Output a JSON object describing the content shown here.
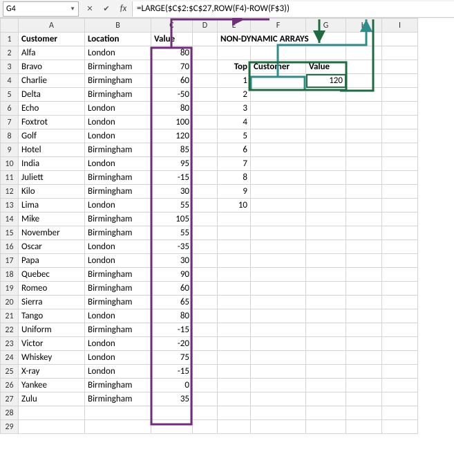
{
  "name_box": "G4",
  "formula": "=LARGE($C$2:$C$27,ROW(F4)-ROW(F$3))",
  "col_headers": [
    "A",
    "B",
    "C",
    "D",
    "E",
    "F",
    "G",
    "H",
    "I"
  ],
  "headers_row1": {
    "customer": "Customer",
    "location": "Location",
    "value": "Value",
    "nonDyn": "NON-DYNAMIC ARRAYS"
  },
  "sub_headers": {
    "top": "Top",
    "customer": "Customer",
    "value": "Value"
  },
  "g4_value": "120",
  "top_numbers": [
    "1",
    "2",
    "3",
    "4",
    "5",
    "6",
    "7",
    "8",
    "9",
    "10"
  ],
  "rows": [
    {
      "n": "2",
      "cust": "Alfa",
      "loc": "London",
      "val": "80"
    },
    {
      "n": "3",
      "cust": "Bravo",
      "loc": "Birmingham",
      "val": "70"
    },
    {
      "n": "4",
      "cust": "Charlie",
      "loc": "Birmingham",
      "val": "60"
    },
    {
      "n": "5",
      "cust": "Delta",
      "loc": "Birmingham",
      "val": "-50"
    },
    {
      "n": "6",
      "cust": "Echo",
      "loc": "London",
      "val": "80"
    },
    {
      "n": "7",
      "cust": "Foxtrot",
      "loc": "London",
      "val": "100"
    },
    {
      "n": "8",
      "cust": "Golf",
      "loc": "London",
      "val": "120"
    },
    {
      "n": "9",
      "cust": "Hotel",
      "loc": "Birmingham",
      "val": "85"
    },
    {
      "n": "10",
      "cust": "India",
      "loc": "London",
      "val": "95"
    },
    {
      "n": "11",
      "cust": "Juliett",
      "loc": "Birmingham",
      "val": "-15"
    },
    {
      "n": "12",
      "cust": "Kilo",
      "loc": "Birmingham",
      "val": "30"
    },
    {
      "n": "13",
      "cust": "Lima",
      "loc": "London",
      "val": "55"
    },
    {
      "n": "14",
      "cust": "Mike",
      "loc": "Birmingham",
      "val": "105"
    },
    {
      "n": "15",
      "cust": "November",
      "loc": "Birmingham",
      "val": "55"
    },
    {
      "n": "16",
      "cust": "Oscar",
      "loc": "London",
      "val": "-35"
    },
    {
      "n": "17",
      "cust": "Papa",
      "loc": "London",
      "val": "30"
    },
    {
      "n": "18",
      "cust": "Quebec",
      "loc": "Birmingham",
      "val": "90"
    },
    {
      "n": "19",
      "cust": "Romeo",
      "loc": "Birmingham",
      "val": "60"
    },
    {
      "n": "20",
      "cust": "Sierra",
      "loc": "Birmingham",
      "val": "65"
    },
    {
      "n": "21",
      "cust": "Tango",
      "loc": "London",
      "val": "80"
    },
    {
      "n": "22",
      "cust": "Uniform",
      "loc": "Birmingham",
      "val": "-15"
    },
    {
      "n": "23",
      "cust": "Victor",
      "loc": "London",
      "val": "-20"
    },
    {
      "n": "24",
      "cust": "Whiskey",
      "loc": "London",
      "val": "75"
    },
    {
      "n": "25",
      "cust": "X-ray",
      "loc": "London",
      "val": "-15"
    },
    {
      "n": "26",
      "cust": "Yankee",
      "loc": "Birmingham",
      "val": "0"
    },
    {
      "n": "27",
      "cust": "Zulu",
      "loc": "Birmingham",
      "val": "35"
    }
  ],
  "trace_colors": {
    "purple": "#6f2e7a",
    "darkgreen": "#1e6b3f",
    "teal": "#2c8d8a"
  }
}
